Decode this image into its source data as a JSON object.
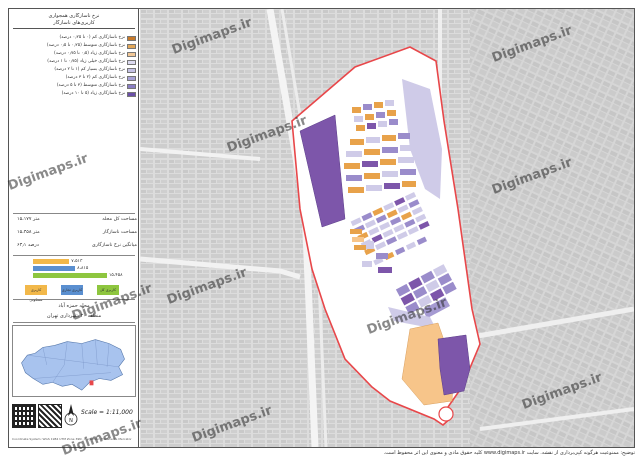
{
  "legend": {
    "title": "نرخ ناسازگاری همجواری",
    "subtitle": "کاربری‌های ناسازگار",
    "classes": [
      {
        "label": "نرخ ناسازگاری کم (۰ تا ۰٫۲۵ درصد)",
        "color": "#c87a2a"
      },
      {
        "label": "نرخ ناسازگاری متوسط (۰٫۲۵ تا ۰٫۵ درصد)",
        "color": "#e3a85a"
      },
      {
        "label": "نرخ ناسازگاری زیاد (۰٫۵ تا ۰٫۷۵ درصد)",
        "color": "#f2c897"
      },
      {
        "label": "نرخ ناسازگاری خیلی زیاد (۰٫۷۵ تا ۱ درصد)",
        "color": "#dcdaf0"
      },
      {
        "label": "نرخ ناسازگاری بسیار کم (۱ تا ۲ درصد)",
        "color": "#c5c2e6"
      },
      {
        "label": "نرخ ناسازگاری کم (۲ تا ۳ درصد)",
        "color": "#a8a2d6"
      },
      {
        "label": "نرخ ناسازگاری متوسط (۳ تا ۵ درصد)",
        "color": "#8a7ec4"
      },
      {
        "label": "نرخ ناسازگاری زیاد (۵ تا ۱۰ درصد)",
        "color": "#6a4fa8"
      }
    ]
  },
  "stats": [
    {
      "label": "مساحت کل محله",
      "value": "۱۵،۱۷۷ متر"
    },
    {
      "label": "مساحت ناسازگار",
      "value": "۱۵،۴۵۸ متر"
    },
    {
      "label": "میانگین نرخ ناسازگاری",
      "value": "۶۳٫۱ درصد"
    }
  ],
  "bars": [
    {
      "value": "۷،۵۱۳",
      "color": "#f2b84a",
      "fraction": 0.49
    },
    {
      "value": "۸،۸۱۵",
      "color": "#5a8fd0",
      "fraction": 0.57
    },
    {
      "value": "۱۵،۴۵۸",
      "color": "#8ec63f",
      "fraction": 1.0
    }
  ],
  "bar_keys": [
    {
      "label": "کاربری مسکونی",
      "color": "#f2b84a"
    },
    {
      "label": "کاربری تجاری",
      "color": "#5a8fd0"
    },
    {
      "label": "کاربری کل",
      "color": "#8ec63f"
    }
  ],
  "location": {
    "title": "محله حمزه آباد",
    "subtitle": "منطقه ۲۰ شهرداری تهران"
  },
  "scale": "Scale = 1:11,000",
  "footer_tiny": "Coordinate System: WGS 1984 UTM Zone 39N · Projection: Transverse Mercator",
  "watermark": "Digimaps.ir",
  "credit": "توضیح: ممنوعیت هرگونه کپی‌برداری از نقشه. سایت www.digimaps.ir کلیه حقوق مادی و معنوی این اثر محفوظ است.",
  "colors": {
    "boundary": "#e8474a",
    "residential_orange": "#e8a24a",
    "peach": "#f7c58a",
    "purple_dark": "#7d56aa",
    "purple_mid": "#9a8ccb",
    "lavender": "#cfcbe8",
    "map_bg": "#d9d9d9"
  }
}
